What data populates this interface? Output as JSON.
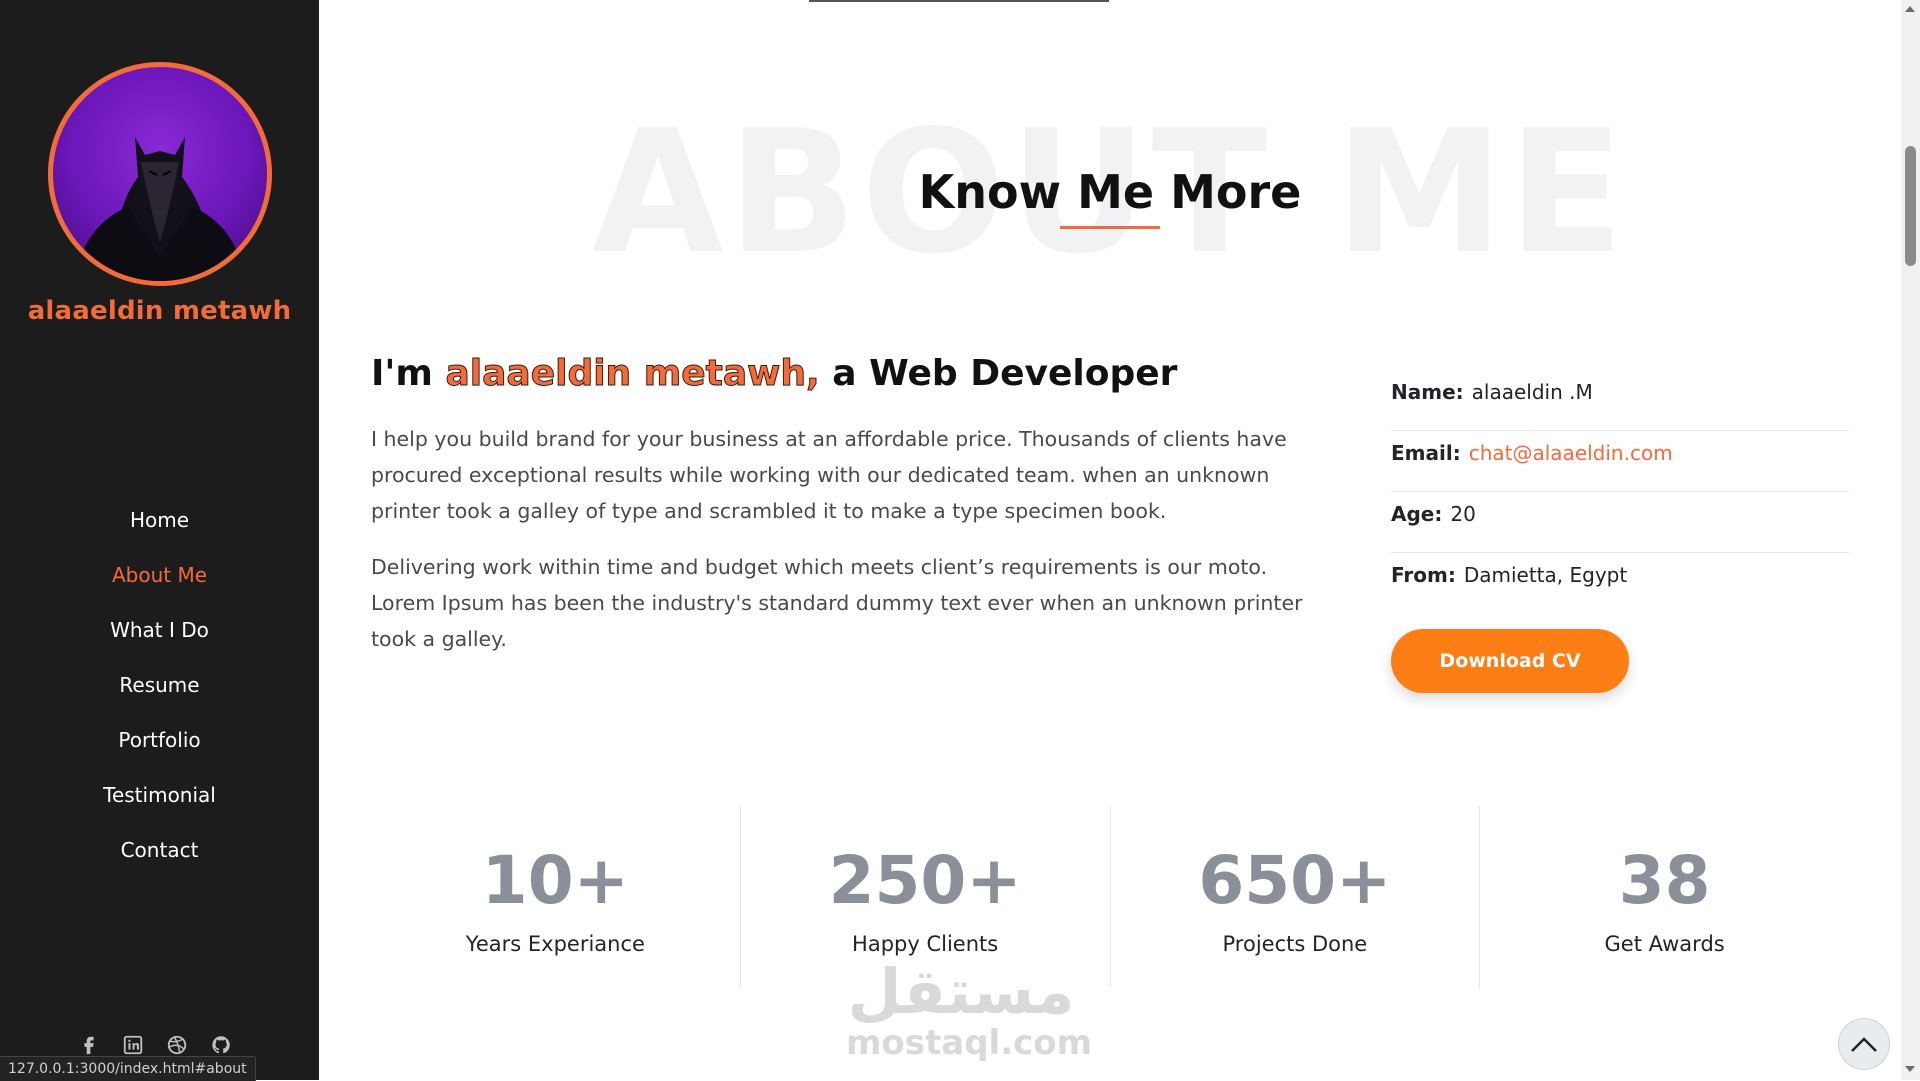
{
  "sidebar": {
    "owner_name": "alaaeldin metawh",
    "nav": [
      {
        "label": "Home",
        "active": false
      },
      {
        "label": "About Me",
        "active": true
      },
      {
        "label": "What I Do",
        "active": false
      },
      {
        "label": "Resume",
        "active": false
      },
      {
        "label": "Portfolio",
        "active": false
      },
      {
        "label": "Testimonial",
        "active": false
      },
      {
        "label": "Contact",
        "active": false
      }
    ],
    "socials": [
      "facebook-icon",
      "linkedin-icon",
      "dribbble-icon",
      "github-icon"
    ],
    "status_url": "127.0.0.1:3000/index.html#about"
  },
  "about": {
    "bg_title": "ABOUT ME",
    "title": "Know Me More",
    "intro_prefix": "I'm ",
    "intro_name": "alaaeldin metawh,",
    "intro_suffix": " a Web Developer",
    "paragraph1": "I help you build brand for your business at an affordable price. Thousands of clients have procured exceptional results while working with our dedicated team. when an unknown printer took a galley of type and scrambled it to make a type specimen book.",
    "paragraph2": "Delivering work within time and budget which meets client’s requirements is our moto. Lorem Ipsum has been the industry's standard dummy text ever when an unknown printer took a galley.",
    "details": {
      "name_label": "Name:",
      "name_value": "alaaeldin .M",
      "email_label": "Email:",
      "email_value": "chat@alaaeldin.com",
      "age_label": "Age:",
      "age_value": "20",
      "from_label": "From:",
      "from_value": "Damietta, Egypt"
    },
    "cv_button": "Download CV"
  },
  "stats": [
    {
      "value": "10+",
      "label": "Years Experiance"
    },
    {
      "value": "250+",
      "label": "Happy Clients"
    },
    {
      "value": "650+",
      "label": "Projects Done"
    },
    {
      "value": "38",
      "label": "Get Awards"
    }
  ],
  "watermark": {
    "arabic": "مستقل",
    "latin": "mostaql.com"
  },
  "colors": {
    "accent": "#f26b3a",
    "button": "#fd7e14",
    "sidebar": "#1c1c1c"
  }
}
